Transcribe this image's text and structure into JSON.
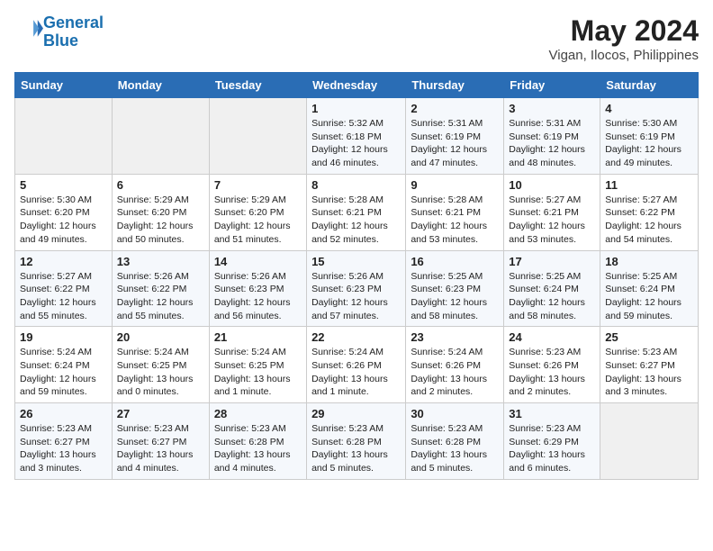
{
  "header": {
    "logo_line1": "General",
    "logo_line2": "Blue",
    "title": "May 2024",
    "subtitle": "Vigan, Ilocos, Philippines"
  },
  "weekdays": [
    "Sunday",
    "Monday",
    "Tuesday",
    "Wednesday",
    "Thursday",
    "Friday",
    "Saturday"
  ],
  "weeks": [
    [
      {
        "day": "",
        "info": ""
      },
      {
        "day": "",
        "info": ""
      },
      {
        "day": "",
        "info": ""
      },
      {
        "day": "1",
        "info": "Sunrise: 5:32 AM\nSunset: 6:18 PM\nDaylight: 12 hours and 46 minutes."
      },
      {
        "day": "2",
        "info": "Sunrise: 5:31 AM\nSunset: 6:19 PM\nDaylight: 12 hours and 47 minutes."
      },
      {
        "day": "3",
        "info": "Sunrise: 5:31 AM\nSunset: 6:19 PM\nDaylight: 12 hours and 48 minutes."
      },
      {
        "day": "4",
        "info": "Sunrise: 5:30 AM\nSunset: 6:19 PM\nDaylight: 12 hours and 49 minutes."
      }
    ],
    [
      {
        "day": "5",
        "info": "Sunrise: 5:30 AM\nSunset: 6:20 PM\nDaylight: 12 hours and 49 minutes."
      },
      {
        "day": "6",
        "info": "Sunrise: 5:29 AM\nSunset: 6:20 PM\nDaylight: 12 hours and 50 minutes."
      },
      {
        "day": "7",
        "info": "Sunrise: 5:29 AM\nSunset: 6:20 PM\nDaylight: 12 hours and 51 minutes."
      },
      {
        "day": "8",
        "info": "Sunrise: 5:28 AM\nSunset: 6:21 PM\nDaylight: 12 hours and 52 minutes."
      },
      {
        "day": "9",
        "info": "Sunrise: 5:28 AM\nSunset: 6:21 PM\nDaylight: 12 hours and 53 minutes."
      },
      {
        "day": "10",
        "info": "Sunrise: 5:27 AM\nSunset: 6:21 PM\nDaylight: 12 hours and 53 minutes."
      },
      {
        "day": "11",
        "info": "Sunrise: 5:27 AM\nSunset: 6:22 PM\nDaylight: 12 hours and 54 minutes."
      }
    ],
    [
      {
        "day": "12",
        "info": "Sunrise: 5:27 AM\nSunset: 6:22 PM\nDaylight: 12 hours and 55 minutes."
      },
      {
        "day": "13",
        "info": "Sunrise: 5:26 AM\nSunset: 6:22 PM\nDaylight: 12 hours and 55 minutes."
      },
      {
        "day": "14",
        "info": "Sunrise: 5:26 AM\nSunset: 6:23 PM\nDaylight: 12 hours and 56 minutes."
      },
      {
        "day": "15",
        "info": "Sunrise: 5:26 AM\nSunset: 6:23 PM\nDaylight: 12 hours and 57 minutes."
      },
      {
        "day": "16",
        "info": "Sunrise: 5:25 AM\nSunset: 6:23 PM\nDaylight: 12 hours and 58 minutes."
      },
      {
        "day": "17",
        "info": "Sunrise: 5:25 AM\nSunset: 6:24 PM\nDaylight: 12 hours and 58 minutes."
      },
      {
        "day": "18",
        "info": "Sunrise: 5:25 AM\nSunset: 6:24 PM\nDaylight: 12 hours and 59 minutes."
      }
    ],
    [
      {
        "day": "19",
        "info": "Sunrise: 5:24 AM\nSunset: 6:24 PM\nDaylight: 12 hours and 59 minutes."
      },
      {
        "day": "20",
        "info": "Sunrise: 5:24 AM\nSunset: 6:25 PM\nDaylight: 13 hours and 0 minutes."
      },
      {
        "day": "21",
        "info": "Sunrise: 5:24 AM\nSunset: 6:25 PM\nDaylight: 13 hours and 1 minute."
      },
      {
        "day": "22",
        "info": "Sunrise: 5:24 AM\nSunset: 6:26 PM\nDaylight: 13 hours and 1 minute."
      },
      {
        "day": "23",
        "info": "Sunrise: 5:24 AM\nSunset: 6:26 PM\nDaylight: 13 hours and 2 minutes."
      },
      {
        "day": "24",
        "info": "Sunrise: 5:23 AM\nSunset: 6:26 PM\nDaylight: 13 hours and 2 minutes."
      },
      {
        "day": "25",
        "info": "Sunrise: 5:23 AM\nSunset: 6:27 PM\nDaylight: 13 hours and 3 minutes."
      }
    ],
    [
      {
        "day": "26",
        "info": "Sunrise: 5:23 AM\nSunset: 6:27 PM\nDaylight: 13 hours and 3 minutes."
      },
      {
        "day": "27",
        "info": "Sunrise: 5:23 AM\nSunset: 6:27 PM\nDaylight: 13 hours and 4 minutes."
      },
      {
        "day": "28",
        "info": "Sunrise: 5:23 AM\nSunset: 6:28 PM\nDaylight: 13 hours and 4 minutes."
      },
      {
        "day": "29",
        "info": "Sunrise: 5:23 AM\nSunset: 6:28 PM\nDaylight: 13 hours and 5 minutes."
      },
      {
        "day": "30",
        "info": "Sunrise: 5:23 AM\nSunset: 6:28 PM\nDaylight: 13 hours and 5 minutes."
      },
      {
        "day": "31",
        "info": "Sunrise: 5:23 AM\nSunset: 6:29 PM\nDaylight: 13 hours and 6 minutes."
      },
      {
        "day": "",
        "info": ""
      }
    ]
  ]
}
